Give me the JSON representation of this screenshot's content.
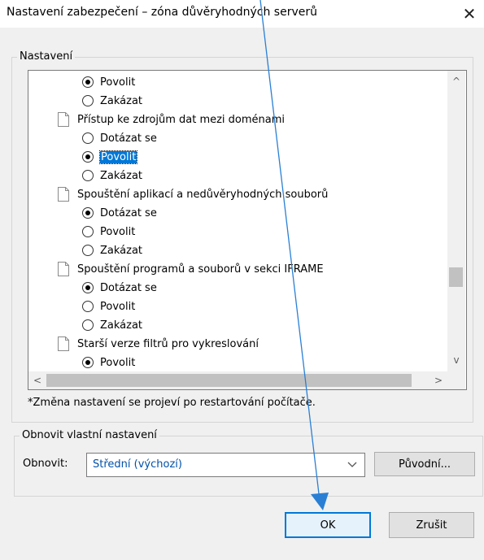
{
  "window": {
    "title": "Nastavení zabezpečení – zóna důvěryhodných serverů",
    "close_glyph": "✕"
  },
  "settings_group": {
    "label": "Nastavení"
  },
  "list": {
    "items": [
      {
        "kind": "radio",
        "label": "Povolit",
        "checked": true
      },
      {
        "kind": "radio",
        "label": "Zakázat",
        "checked": false
      },
      {
        "kind": "heading",
        "label": "Přístup ke zdrojům dat mezi doménami"
      },
      {
        "kind": "radio",
        "label": "Dotázat se",
        "checked": false
      },
      {
        "kind": "radio",
        "label": "Povolit",
        "checked": true,
        "selected": true
      },
      {
        "kind": "radio",
        "label": "Zakázat",
        "checked": false
      },
      {
        "kind": "heading",
        "label": "Spouštění aplikací a nedůvěryhodných souborů"
      },
      {
        "kind": "radio",
        "label": "Dotázat se",
        "checked": true
      },
      {
        "kind": "radio",
        "label": "Povolit",
        "checked": false
      },
      {
        "kind": "radio",
        "label": "Zakázat",
        "checked": false
      },
      {
        "kind": "heading",
        "label": "Spouštění programů a souborů v sekci IFRAME"
      },
      {
        "kind": "radio",
        "label": "Dotázat se",
        "checked": true
      },
      {
        "kind": "radio",
        "label": "Povolit",
        "checked": false
      },
      {
        "kind": "radio",
        "label": "Zakázat",
        "checked": false
      },
      {
        "kind": "heading",
        "label": "Starší verze filtrů pro vykreslování"
      },
      {
        "kind": "radio",
        "label": "Povolit",
        "checked": true
      }
    ]
  },
  "scrollbars": {
    "up": "^",
    "down": "v",
    "left": "<",
    "right": ">"
  },
  "restart_note": "*Změna nastavení se projeví po restartování počítače.",
  "reset_group": {
    "label": "Obnovit vlastní nastavení",
    "reset_label": "Obnovit:",
    "selected_value": "Střední (výchozí)",
    "reset_button": "Původní..."
  },
  "footer": {
    "ok_label": "OK",
    "cancel_label": "Zrušit"
  },
  "colors": {
    "accent": "#0078d7",
    "pointer": "#2a7fd4",
    "selected_text_bg": "#0078d7",
    "combo_text": "#0050a8"
  }
}
